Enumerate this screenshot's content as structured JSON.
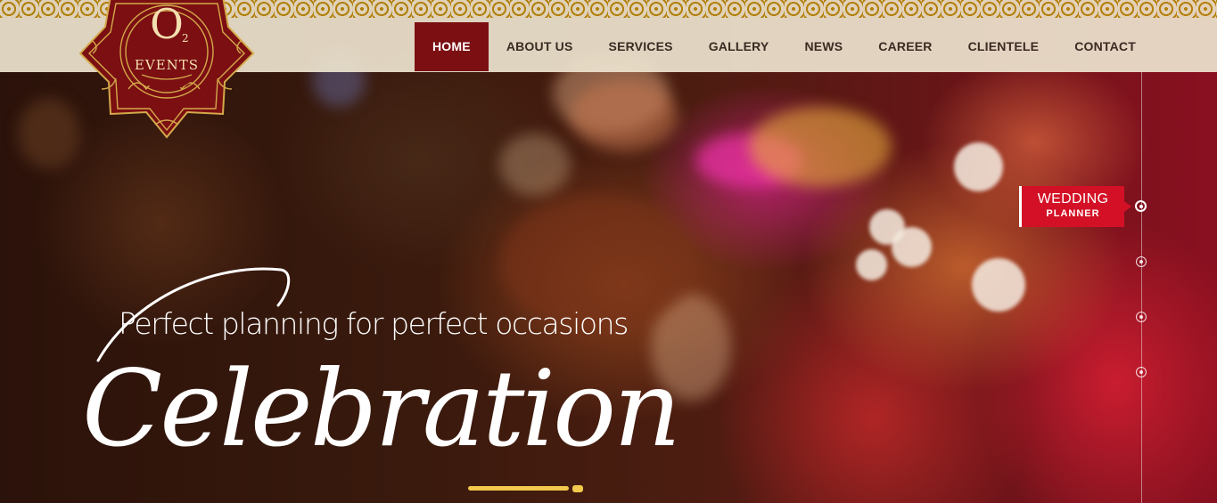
{
  "logo": {
    "alt": "O2 Events",
    "brand_letter": "O",
    "subscript": "2",
    "word": "EVENTS"
  },
  "nav": {
    "items": [
      {
        "label": "HOME",
        "active": true
      },
      {
        "label": "ABOUT US",
        "active": false
      },
      {
        "label": "SERVICES",
        "active": false
      },
      {
        "label": "GALLERY",
        "active": false
      },
      {
        "label": "NEWS",
        "active": false
      },
      {
        "label": "CAREER",
        "active": false
      },
      {
        "label": "CLIENTELE",
        "active": false
      },
      {
        "label": "CONTACT",
        "active": false
      }
    ]
  },
  "hero": {
    "tagline": "Perfect planning for perfect occasions",
    "headline": "Celebration"
  },
  "slider": {
    "active_label_line1": "WEDDING",
    "active_label_line2": "PLANNER",
    "dot_count": 4,
    "active_index": 0
  },
  "colors": {
    "nav_active_bg": "#7b0f12",
    "slide_label_bg": "#d31026",
    "accent_gold": "#f2c94c",
    "logo_maroon": "#7b0f12",
    "logo_gold": "#d4a94b"
  }
}
